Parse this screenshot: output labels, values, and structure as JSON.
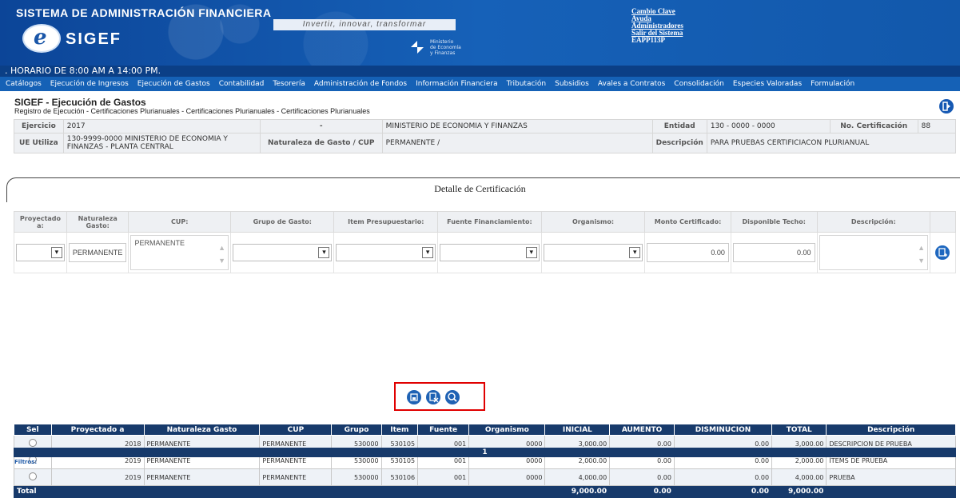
{
  "header": {
    "system_title": "SISTEMA DE ADMINISTRACIÓN FINANCIERA",
    "logo_text": "SIGEF",
    "logo_letter": "e",
    "slogan": "Invertir, innovar, transformar",
    "ministry_lines": [
      "Ministerio",
      "de Economía",
      "y Finanzas"
    ],
    "links": [
      "Cambio Clave",
      "Ayuda",
      "Administradores",
      "Salir del Sistema"
    ],
    "user": "EAPP113P",
    "schedule": ". HORARIO DE 8:00 AM A 14:00 PM."
  },
  "menu": [
    "Catálogos",
    "Ejecución de Ingresos",
    "Ejecución de Gastos",
    "Contabilidad",
    "Tesorería",
    "Administración de Fondos",
    "Información Financiera",
    "Tributación",
    "Subsidios",
    "Avales a Contratos",
    "Consolidación",
    "Especies Valoradas",
    "Formulación"
  ],
  "page": {
    "title": "SIGEF - Ejecución de Gastos",
    "breadcrumb": "Registro de Ejecución - Certificaciones Plurianuales - Certificaciones Plurianuales - Certificaciones Plurianuales"
  },
  "info": {
    "ejercicio_label": "Ejercicio",
    "ejercicio": "2017",
    "dash": "-",
    "ministerio": "MINISTERIO DE ECONOMIA Y FINANZAS",
    "entidad_label": "Entidad",
    "entidad": "130 - 0000 - 0000",
    "cert_label": "No. Certificación",
    "cert": "88",
    "ue_label": "UE Utiliza",
    "ue": "130-9999-0000 MINISTERIO DE ECONOMIA Y FINANZAS - PLANTA CENTRAL",
    "naturaleza_label": "Naturaleza de Gasto / CUP",
    "naturaleza": "PERMANENTE /",
    "descripcion_label": "Descripción",
    "descripcion": "PARA PRUEBAS CERTIFICIACON PLURIANUAL"
  },
  "detail": {
    "title": "Detalle de Certificación",
    "headers": [
      "Proyectado a:",
      "Naturaleza Gasto:",
      "CUP:",
      "Grupo de Gasto:",
      "Item Presupuestario:",
      "Fuente Financiamiento:",
      "Organismo:",
      "Monto Certificado:",
      "Disponible Techo:",
      "Descripción:"
    ],
    "naturaleza_value": "PERMANENTE",
    "cup_value": "PERMANENTE",
    "monto_value": "0.00",
    "disponible_value": "0.00"
  },
  "grid": {
    "headers": [
      "Sel",
      "Proyectado a",
      "Naturaleza Gasto",
      "CUP",
      "Grupo",
      "Item",
      "Fuente",
      "Organismo",
      "INICIAL",
      "AUMENTO",
      "DISMINUCION",
      "TOTAL",
      "Descripción"
    ],
    "rows": [
      [
        "2018",
        "PERMANENTE",
        "PERMANENTE",
        "530000",
        "530105",
        "001",
        "0000",
        "3,000.00",
        "0.00",
        "0.00",
        "3,000.00",
        "DESCRIPCION DE PRUEBA"
      ],
      [
        "2019",
        "PERMANENTE",
        "PERMANENTE",
        "530000",
        "530105",
        "001",
        "0000",
        "2,000.00",
        "0.00",
        "0.00",
        "2,000.00",
        "ÍTEMS DE PRUEBA"
      ],
      [
        "2019",
        "PERMANENTE",
        "PERMANENTE",
        "530000",
        "530106",
        "001",
        "0000",
        "4,000.00",
        "0.00",
        "0.00",
        "4,000.00",
        "PRUEBA"
      ]
    ],
    "total_label": "Total",
    "totals": {
      "inicial": "9,000.00",
      "aumento": "0.00",
      "disminucion": "0.00",
      "total": "9,000.00"
    },
    "page": "1",
    "filters": "Filtros:"
  }
}
